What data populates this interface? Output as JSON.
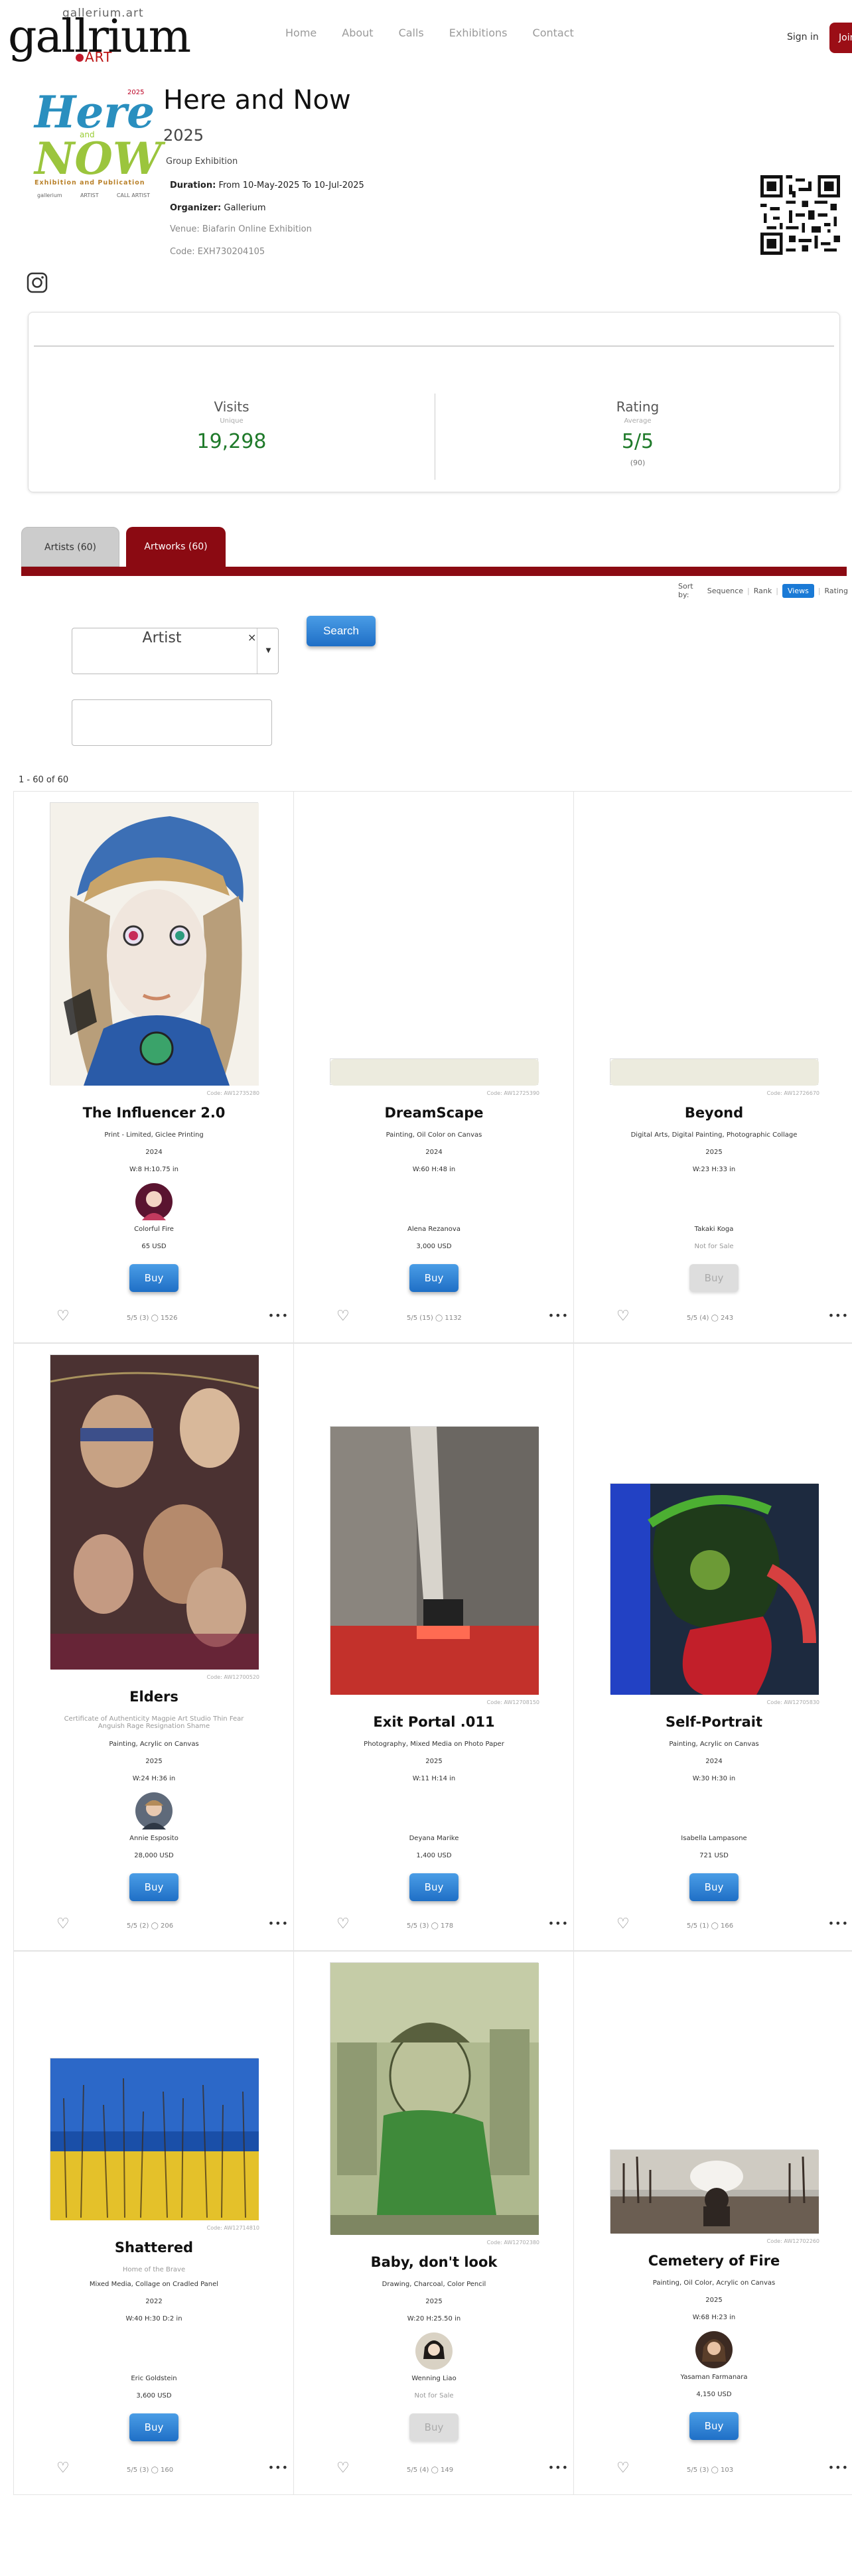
{
  "header": {
    "logo_top": "gallerium.art",
    "logo_main": "gallrium",
    "logo_art": "ART",
    "nav": [
      "Home",
      "About",
      "Calls",
      "Exhibitions",
      "Contact"
    ],
    "signin": "Sign in",
    "join": "Join"
  },
  "poster": {
    "here": "Here",
    "year": "2025",
    "and": "and",
    "now": "NOW",
    "subtitle": "Exhibition and Publication",
    "logos": [
      "gallerium",
      "ARTIST",
      "CALL ARTIST"
    ]
  },
  "exhibition": {
    "title": "Here and Now",
    "year": "2025",
    "type": "Group Exhibition",
    "duration_label": "Duration:",
    "duration": "From 10-May-2025 To 10-Jul-2025",
    "organizer_label": "Organizer:",
    "organizer": "Gallerium",
    "venue_label": "Venue:",
    "venue": "Biafarin Online Exhibition",
    "code": "Code: EXH730204105"
  },
  "stats": {
    "visits_label": "Visits",
    "visits_sub": "Unique",
    "visits_value": "19,298",
    "rating_label": "Rating",
    "rating_sub": "Average",
    "rating_value": "5/5",
    "rating_count": "(90)"
  },
  "tabs": {
    "artists": "Artists (60)",
    "artworks": "Artworks (60)"
  },
  "sort": {
    "label": "Sort by:",
    "options": [
      "Sequence",
      "Rank",
      "Views",
      "Rating"
    ],
    "active": "Views"
  },
  "filters": {
    "artist_label": "Artist",
    "clear": "×",
    "search": "Search"
  },
  "results_count": "1 - 60 of 60",
  "colors": {
    "brand_red": "#8b0a12",
    "button_blue": "#1f6fc6",
    "stat_green": "#1f7a2a"
  },
  "artworks": [
    {
      "code": "Code: AW12735280",
      "title": "The Influencer 2.0",
      "subtitle": "",
      "medium": "Print - Limited, Giclee Printing",
      "year": "2024",
      "size": "W:8 H:10.75 in",
      "artist": "Colorful Fire",
      "price": "65 USD",
      "buy": "Buy",
      "buy_enabled": true,
      "stats": "5/5 (3)  ◯ 1526",
      "image": "portrait-woman"
    },
    {
      "code": "Code: AW12725390",
      "title": "DreamScape",
      "subtitle": "",
      "medium": "Painting, Oil Color on Canvas",
      "year": "2024",
      "size": "W:60 H:48 in",
      "artist": "Alena Rezanova",
      "price": "3,000 USD",
      "buy": "Buy",
      "buy_enabled": true,
      "stats": "5/5 (15)  ◯ 1132",
      "image": "pale-strip"
    },
    {
      "code": "Code: AW12726670",
      "title": "Beyond",
      "subtitle": "",
      "medium": "Digital Arts, Digital Painting, Photographic Collage",
      "year": "2025",
      "size": "W:23 H:33 in",
      "artist": "Takaki Koga",
      "price": "Not for Sale",
      "buy": "Buy",
      "buy_enabled": false,
      "stats": "5/5 (4)  ◯ 243",
      "image": "pale-strip"
    },
    {
      "code": "Code: AW12700520",
      "title": "Elders",
      "subtitle": "Certificate of Authenticity Magpie Art Studio Thin Fear Anguish Rage Resignation Shame",
      "medium": "Painting, Acrylic on Canvas",
      "year": "2025",
      "size": "W:24 H:36 in",
      "artist": "Annie Esposito",
      "price": "28,000 USD",
      "buy": "Buy",
      "buy_enabled": true,
      "stats": "5/5 (2)  ◯ 206",
      "image": "elders"
    },
    {
      "code": "Code: AW12708150",
      "title": "Exit Portal .011",
      "subtitle": "",
      "medium": "Photography, Mixed Media on Photo Paper",
      "year": "2025",
      "size": "W:11 H:14 in",
      "artist": "Deyana Marike",
      "price": "1,400 USD",
      "buy": "Buy",
      "buy_enabled": true,
      "stats": "5/5 (3)  ◯ 178",
      "image": "exit-portal"
    },
    {
      "code": "Code: AW12705830",
      "title": "Self-Portrait",
      "subtitle": "",
      "medium": "Painting, Acrylic on Canvas",
      "year": "2024",
      "size": "W:30 H:30 in",
      "artist": "Isabella Lampasone",
      "price": "721 USD",
      "buy": "Buy",
      "buy_enabled": true,
      "stats": "5/5 (1)  ◯ 166",
      "image": "self-portrait"
    },
    {
      "code": "Code: AW12714810",
      "title": "Shattered",
      "subtitle": "Home of the Brave",
      "medium": "Mixed Media, Collage on Cradled Panel",
      "year": "2022",
      "size": "W:40 H:30 D:2 in",
      "artist": "Eric Goldstein",
      "price": "3,600 USD",
      "buy": "Buy",
      "buy_enabled": true,
      "stats": "5/5 (3)  ◯ 160",
      "image": "shattered"
    },
    {
      "code": "Code: AW12702380",
      "title": "Baby, don't look",
      "subtitle": "",
      "medium": "Drawing, Charcoal, Color Pencil",
      "year": "2025",
      "size": "W:20 H:25.50 in",
      "artist": "Wenning Liao",
      "price": "Not for Sale",
      "buy": "Buy",
      "buy_enabled": false,
      "stats": "5/5 (4)  ◯ 149",
      "image": "baby"
    },
    {
      "code": "Code: AW12702260",
      "title": "Cemetery of Fire",
      "subtitle": "",
      "medium": "Painting, Oil Color, Acrylic on Canvas",
      "year": "2025",
      "size": "W:68 H:23 in",
      "artist": "Yasaman Farmanara",
      "price": "4,150 USD",
      "buy": "Buy",
      "buy_enabled": true,
      "stats": "5/5 (3)  ◯ 103",
      "image": "cemetery"
    }
  ]
}
